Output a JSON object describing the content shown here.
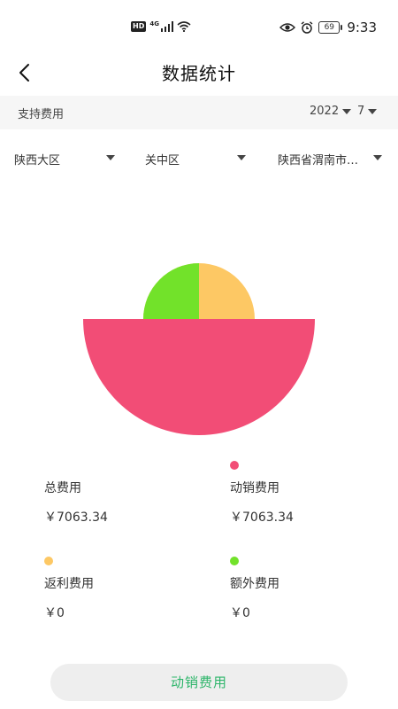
{
  "status_bar": {
    "hd": "HD",
    "network": "4G",
    "battery": "69",
    "time": "9:33"
  },
  "header": {
    "title": "数据统计"
  },
  "filters": {
    "label": "支持费用",
    "year": "2022",
    "month": "7"
  },
  "regions": [
    {
      "label": "陕西大区"
    },
    {
      "label": "关中区"
    },
    {
      "label": "陕西省渭南市…"
    }
  ],
  "legend": {
    "total": {
      "name": "总费用",
      "value": "￥7063.34"
    },
    "items": [
      {
        "name": "动销费用",
        "value": "￥7063.34",
        "color": "#f24d76"
      },
      {
        "name": "返利费用",
        "value": "￥0",
        "color": "#fdc864"
      },
      {
        "name": "额外费用",
        "value": "￥0",
        "color": "#72e22a"
      }
    ]
  },
  "bottom_button": {
    "label": "动销费用"
  },
  "colors": {
    "pink": "#f24d76",
    "yellow": "#fdc864",
    "green": "#72e22a",
    "button_text": "#2db56a"
  }
}
